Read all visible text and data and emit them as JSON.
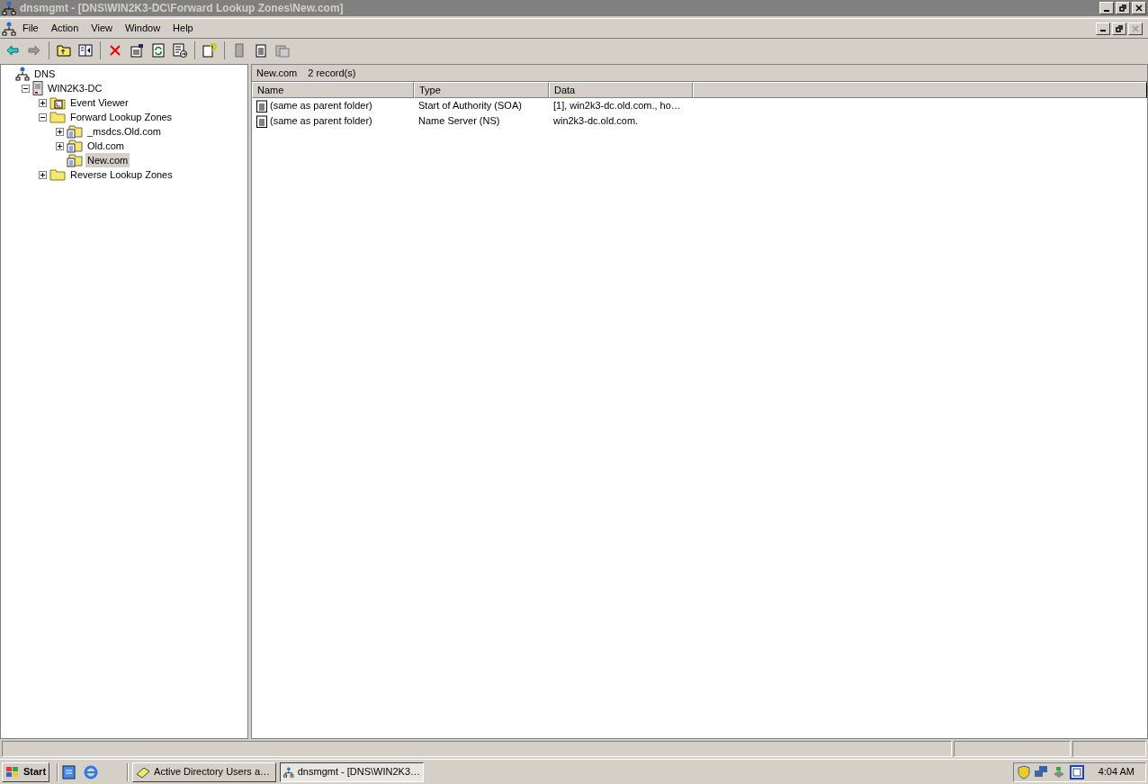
{
  "window": {
    "title": "dnsmgmt - [DNS\\WIN2K3-DC\\Forward Lookup Zones\\New.com]"
  },
  "menu": [
    "File",
    "Action",
    "View",
    "Window",
    "Help"
  ],
  "tree": [
    {
      "label": "DNS",
      "kind": "dns",
      "selected": false,
      "children": [
        {
          "label": "WIN2K3-DC",
          "kind": "server",
          "selected": false,
          "expanded": true,
          "children": [
            {
              "label": "Event Viewer",
              "kind": "event",
              "selected": false,
              "expanded": false
            },
            {
              "label": "Forward Lookup Zones",
              "kind": "folder",
              "selected": false,
              "expanded": true,
              "children": [
                {
                  "label": "_msdcs.Old.com",
                  "kind": "zone",
                  "selected": false,
                  "expanded": false
                },
                {
                  "label": "Old.com",
                  "kind": "zone",
                  "selected": false,
                  "expanded": false
                },
                {
                  "label": "New.com",
                  "kind": "zone",
                  "selected": true
                }
              ]
            },
            {
              "label": "Reverse Lookup Zones",
              "kind": "folder",
              "selected": false,
              "expanded": false
            }
          ]
        }
      ]
    }
  ],
  "list": {
    "title": "New.com",
    "count": "2 record(s)",
    "columns": [
      "Name",
      "Type",
      "Data"
    ],
    "rows": [
      [
        "(same as parent folder)",
        "Start of Authority (SOA)",
        "[1], win2k3-dc.old.com., ho…"
      ],
      [
        "(same as parent folder)",
        "Name Server (NS)",
        "win2k3-dc.old.com."
      ]
    ]
  },
  "taskbar": {
    "start": "Start",
    "tasks": [
      {
        "label": "Active Directory Users a…",
        "kind": "ad",
        "selected": false
      },
      {
        "label": "dnsmgmt - [DNS\\WIN2K3…",
        "kind": "dns",
        "selected": true
      }
    ],
    "clock": "4:04 AM"
  }
}
